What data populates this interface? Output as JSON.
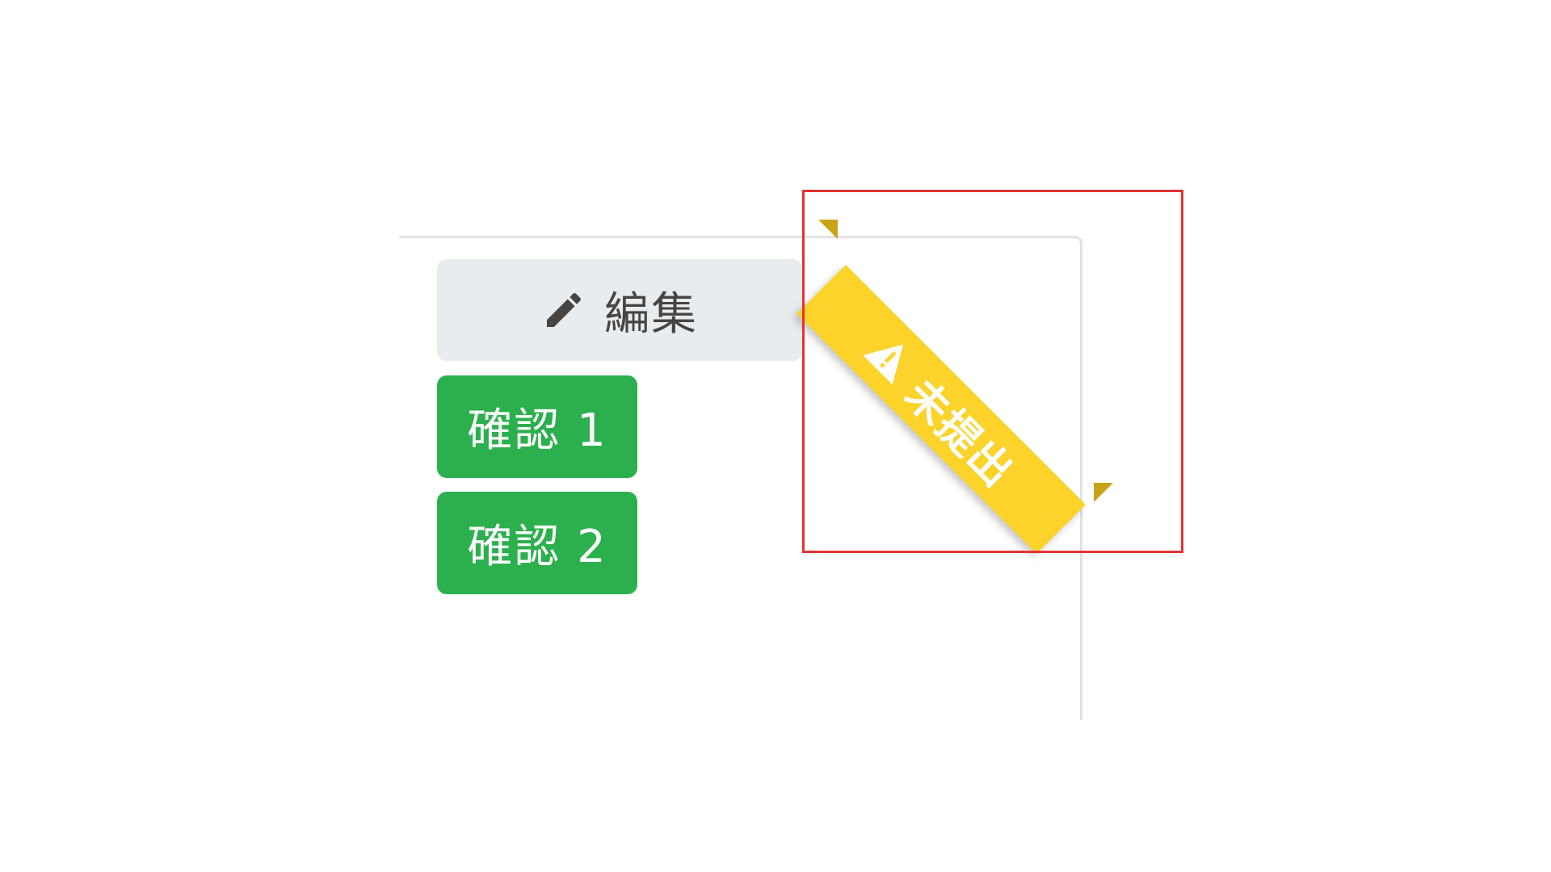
{
  "actions": {
    "edit_label": "編集",
    "edit_icon": "pencil-icon",
    "confirm_1_label": "確認 1",
    "confirm_2_label": "確認 2"
  },
  "ribbon": {
    "label": "未提出",
    "icon": "warning-icon"
  },
  "colors": {
    "edit_bg": "#e9ecef",
    "edit_text": "#454545",
    "confirm_bg": "#2cb04d",
    "ribbon_bg": "#fcd32b",
    "ribbon_fold": "#c8a319",
    "highlight": "#e53232",
    "card_border": "#e2e2e2"
  }
}
